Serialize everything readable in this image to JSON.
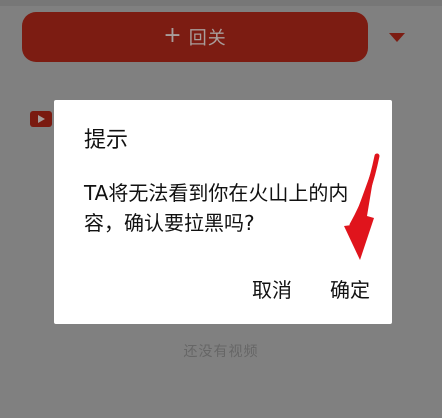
{
  "background": {
    "follow_button": {
      "plus_icon": "+",
      "label": "回关"
    },
    "dropdown_icon": "chevron-down-icon",
    "video_icon": "video-icon",
    "empty_state_text": "还没有视频"
  },
  "dialog": {
    "title": "提示",
    "message": "TA将无法看到你在火山上的内容，确认要拉黑吗?",
    "cancel_label": "取消",
    "confirm_label": "确定"
  },
  "colors": {
    "accent_red": "#7c1c12",
    "arrow_red": "#e0141c",
    "dialog_bg": "#ffffff",
    "overlay": "#808080"
  }
}
